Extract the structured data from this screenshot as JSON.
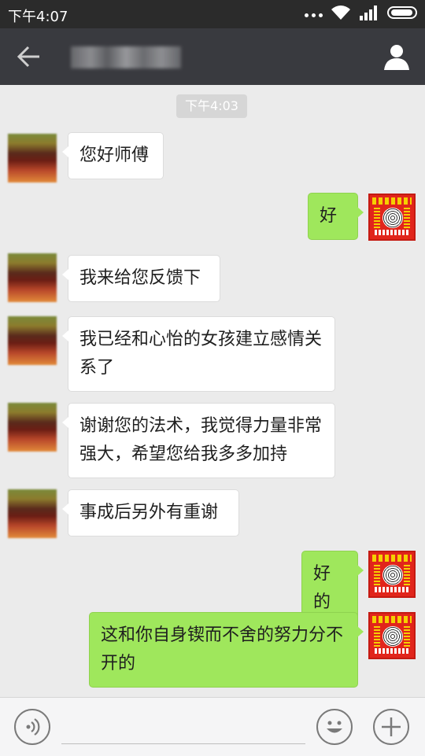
{
  "status_bar": {
    "time": "下午4:07",
    "icons": [
      "more-dots-icon",
      "wifi-icon",
      "signal-icon",
      "battery-icon"
    ]
  },
  "header": {
    "back_icon": "back-arrow-icon",
    "contact_name": "",
    "profile_icon": "person-icon"
  },
  "chat": {
    "timestamp": "下午4:03",
    "messages": [
      {
        "side": "left",
        "text": "您好师傅"
      },
      {
        "side": "right",
        "text": "好"
      },
      {
        "side": "left",
        "text": "我来给您反馈下"
      },
      {
        "side": "left",
        "text": "我已经和心怡的女孩建立感情关系了"
      },
      {
        "side": "left",
        "text": "谢谢您的法术，我觉得力量非常强大，希望您给我多多加持"
      },
      {
        "side": "left",
        "text": "事成后另外有重谢"
      },
      {
        "side": "right",
        "text": "好的"
      },
      {
        "side": "right",
        "text": "这和你自身锲而不舍的努力分不开的"
      }
    ]
  },
  "input_bar": {
    "voice_icon": "voice-icon",
    "emoji_icon": "emoji-icon",
    "plus_icon": "plus-icon",
    "text_value": ""
  },
  "colors": {
    "status_bar_bg": "#2b2b2b",
    "header_bg": "#393a3f",
    "chat_bg": "#ebebeb",
    "incoming_bubble": "#ffffff",
    "outgoing_bubble": "#9fe75c"
  }
}
